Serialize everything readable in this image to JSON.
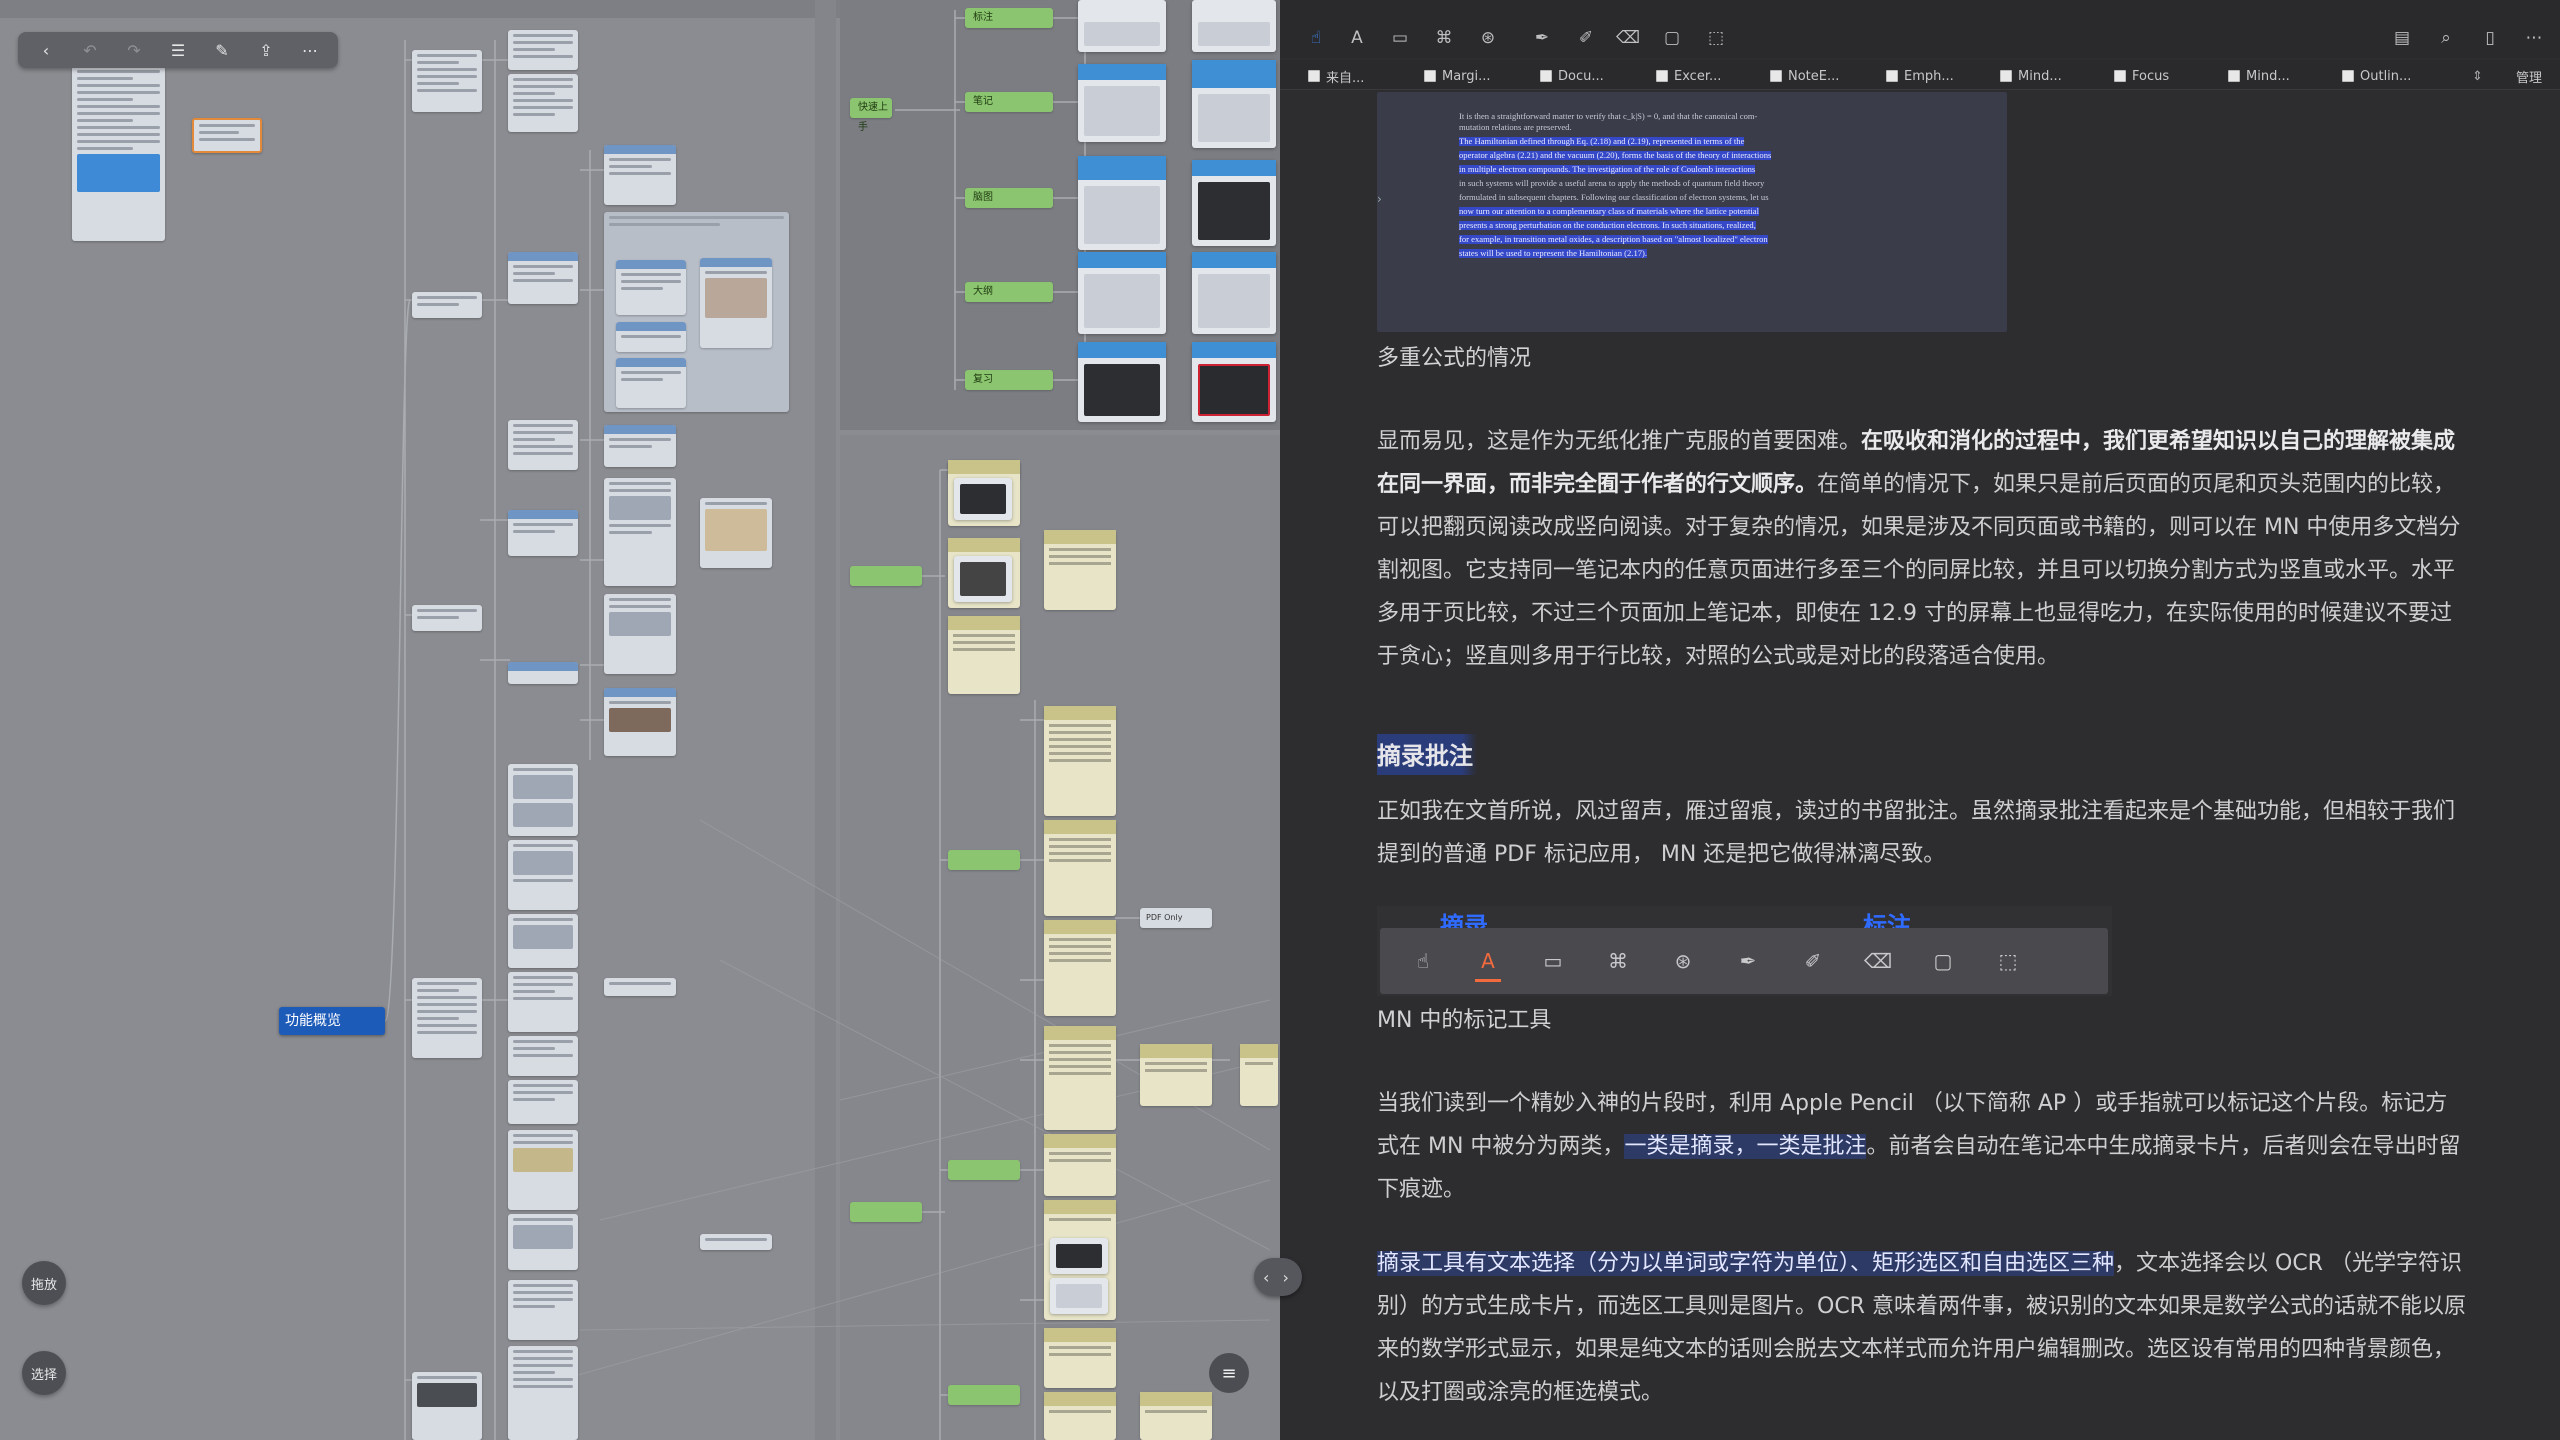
{
  "mindmap": {
    "root_label": "功能概览",
    "overlay_buttons": {
      "drag": "拖放",
      "select": "选择"
    },
    "toolbar": {
      "back_icon": "chevron-left-icon",
      "undo_icon": "undo-icon",
      "redo_icon": "redo-icon",
      "outline_icon": "list-icon",
      "edit_icon": "compose-icon",
      "share_icon": "share-icon",
      "more_icon": "ellipsis-icon"
    },
    "branch_labels": [
      "标注",
      "笔记",
      "脑图",
      "大纲",
      "复习",
      "快速上手",
      "PDF Only"
    ]
  },
  "annotation_toolbar": {
    "tools": [
      "hand-icon",
      "text-highlight-icon",
      "rect-select-icon",
      "freeform-select-icon",
      "shape-select-icon",
      "pen-icon",
      "highlighter-icon",
      "eraser-icon",
      "textbox-icon",
      "lasso-icon"
    ],
    "right_icons": [
      "document-icon",
      "search-icon",
      "bookmark-icon",
      "ellipsis-icon"
    ]
  },
  "tabs": [
    {
      "label": "来自..."
    },
    {
      "label": "Margi..."
    },
    {
      "label": "Docu..."
    },
    {
      "label": "Excer..."
    },
    {
      "label": "NoteE..."
    },
    {
      "label": "Emph..."
    },
    {
      "label": "Mind..."
    },
    {
      "label": "Focus"
    },
    {
      "label": "Mind..."
    },
    {
      "label": "Outlin..."
    }
  ],
  "tabs_manage": "管理",
  "document": {
    "excerpt_lines": [
      {
        "text": "It is then a straightforward matter to verify that c_k|S) = 0, and that the canonical com-",
        "hl": false
      },
      {
        "text": "mutation relations are preserved.",
        "hl": false
      },
      {
        "text": "    The Hamiltonian defined through Eq. (2.18) and (2.19), represented in terms of the",
        "hl": true
      },
      {
        "text": "operator algebra (2.21) and the vacuum (2.20), forms the basis of the theory of interactions",
        "hl": true
      },
      {
        "text": "in multiple electron compounds. The investigation of the role of Coulomb interactions",
        "hl": true
      },
      {
        "text": "in such systems will provide a useful arena to apply the methods of quantum field theory",
        "hl": false
      },
      {
        "text": "formulated in subsequent chapters. Following our classification of electron systems, let us",
        "hl": false
      },
      {
        "text": "now turn our attention to a complementary class of materials where the lattice potential",
        "hl": true
      },
      {
        "text": "presents a strong perturbation on the conduction electrons. In such situations, realized,",
        "hl": true
      },
      {
        "text": "for example, in transition metal oxides, a description based on \"almost localized\" electron",
        "hl": true
      },
      {
        "text": "states will be used to represent the Hamiltonian (2.17).",
        "hl": true
      }
    ],
    "caption_1": "多重公式的情况",
    "para_1_a": "显而易见，这是作为无纸化推广克服的首要困难。",
    "para_1_b": "在吸收和消化的过程中，我们更希望知识以自己的理解被集成在同一界面，而非完全囿于作者的行文顺序。",
    "para_1_c": "在简单的情况下，如果只是前后页面的页尾和页头范围内的比较，可以把翻页阅读改成竖向阅读。对于复杂的情况，如果是涉及不同页面或书籍的，则可以在 MN 中使用多文档分割视图。它支持同一笔记本内的任意页面进行多至三个的同屏比较，并且可以切换分割方式为竖直或水平。水平多用于页比较，不过三个页面加上笔记本，即使在 12.9 寸的屏幕上也显得吃力，在实际使用的时候建议不要过于贪心；竖直则多用于行比较，对照的公式或是对比的段落适合使用。",
    "section_heading": "摘录批注",
    "para_2": "正如我在文首所说，风过留声，雁过留痕，读过的书留批注。虽然摘录批注看起来是个基础功能，但相较于我们提到的普通 PDF 标记应用， MN 还是把它做得淋漓尽致。",
    "tools_label_excerpt": "摘录",
    "tools_label_annotate": "标注",
    "caption_2": "MN 中的标记工具",
    "para_3_a": "当我们读到一个精妙入神的片段时，利用 Apple Pencil （以下简称 AP ）或手指就可以标记这个片段。标记方式在 MN 中被分为两类，",
    "para_3_hl": "一类是摘录，一类是批注",
    "para_3_b": "。前者会自动在笔记本中生成摘录卡片，后者则会在导出时留下痕迹。",
    "para_4_hl": "摘录工具有文本选择（分为以单词或字符为单位）、矩形选区和自由选区三种",
    "para_4_b": "，文本选择会以 OCR （光学字符识别）的方式生成卡片，而选区工具则是图片。OCR 意味着两件事，被识别的文本如果是数学公式的话就不能以原来的数学形式显示，如果是纯文本的话则会脱去文本样式而允许用户编辑删改。选区设有常用的四种背景颜色，以及打圈或涂亮的框选模式。"
  },
  "colors": {
    "accent": "#3d86f0",
    "active_tool": "#f26a3d",
    "root_node": "#1d5bb8",
    "highlight": "#3548c8"
  }
}
